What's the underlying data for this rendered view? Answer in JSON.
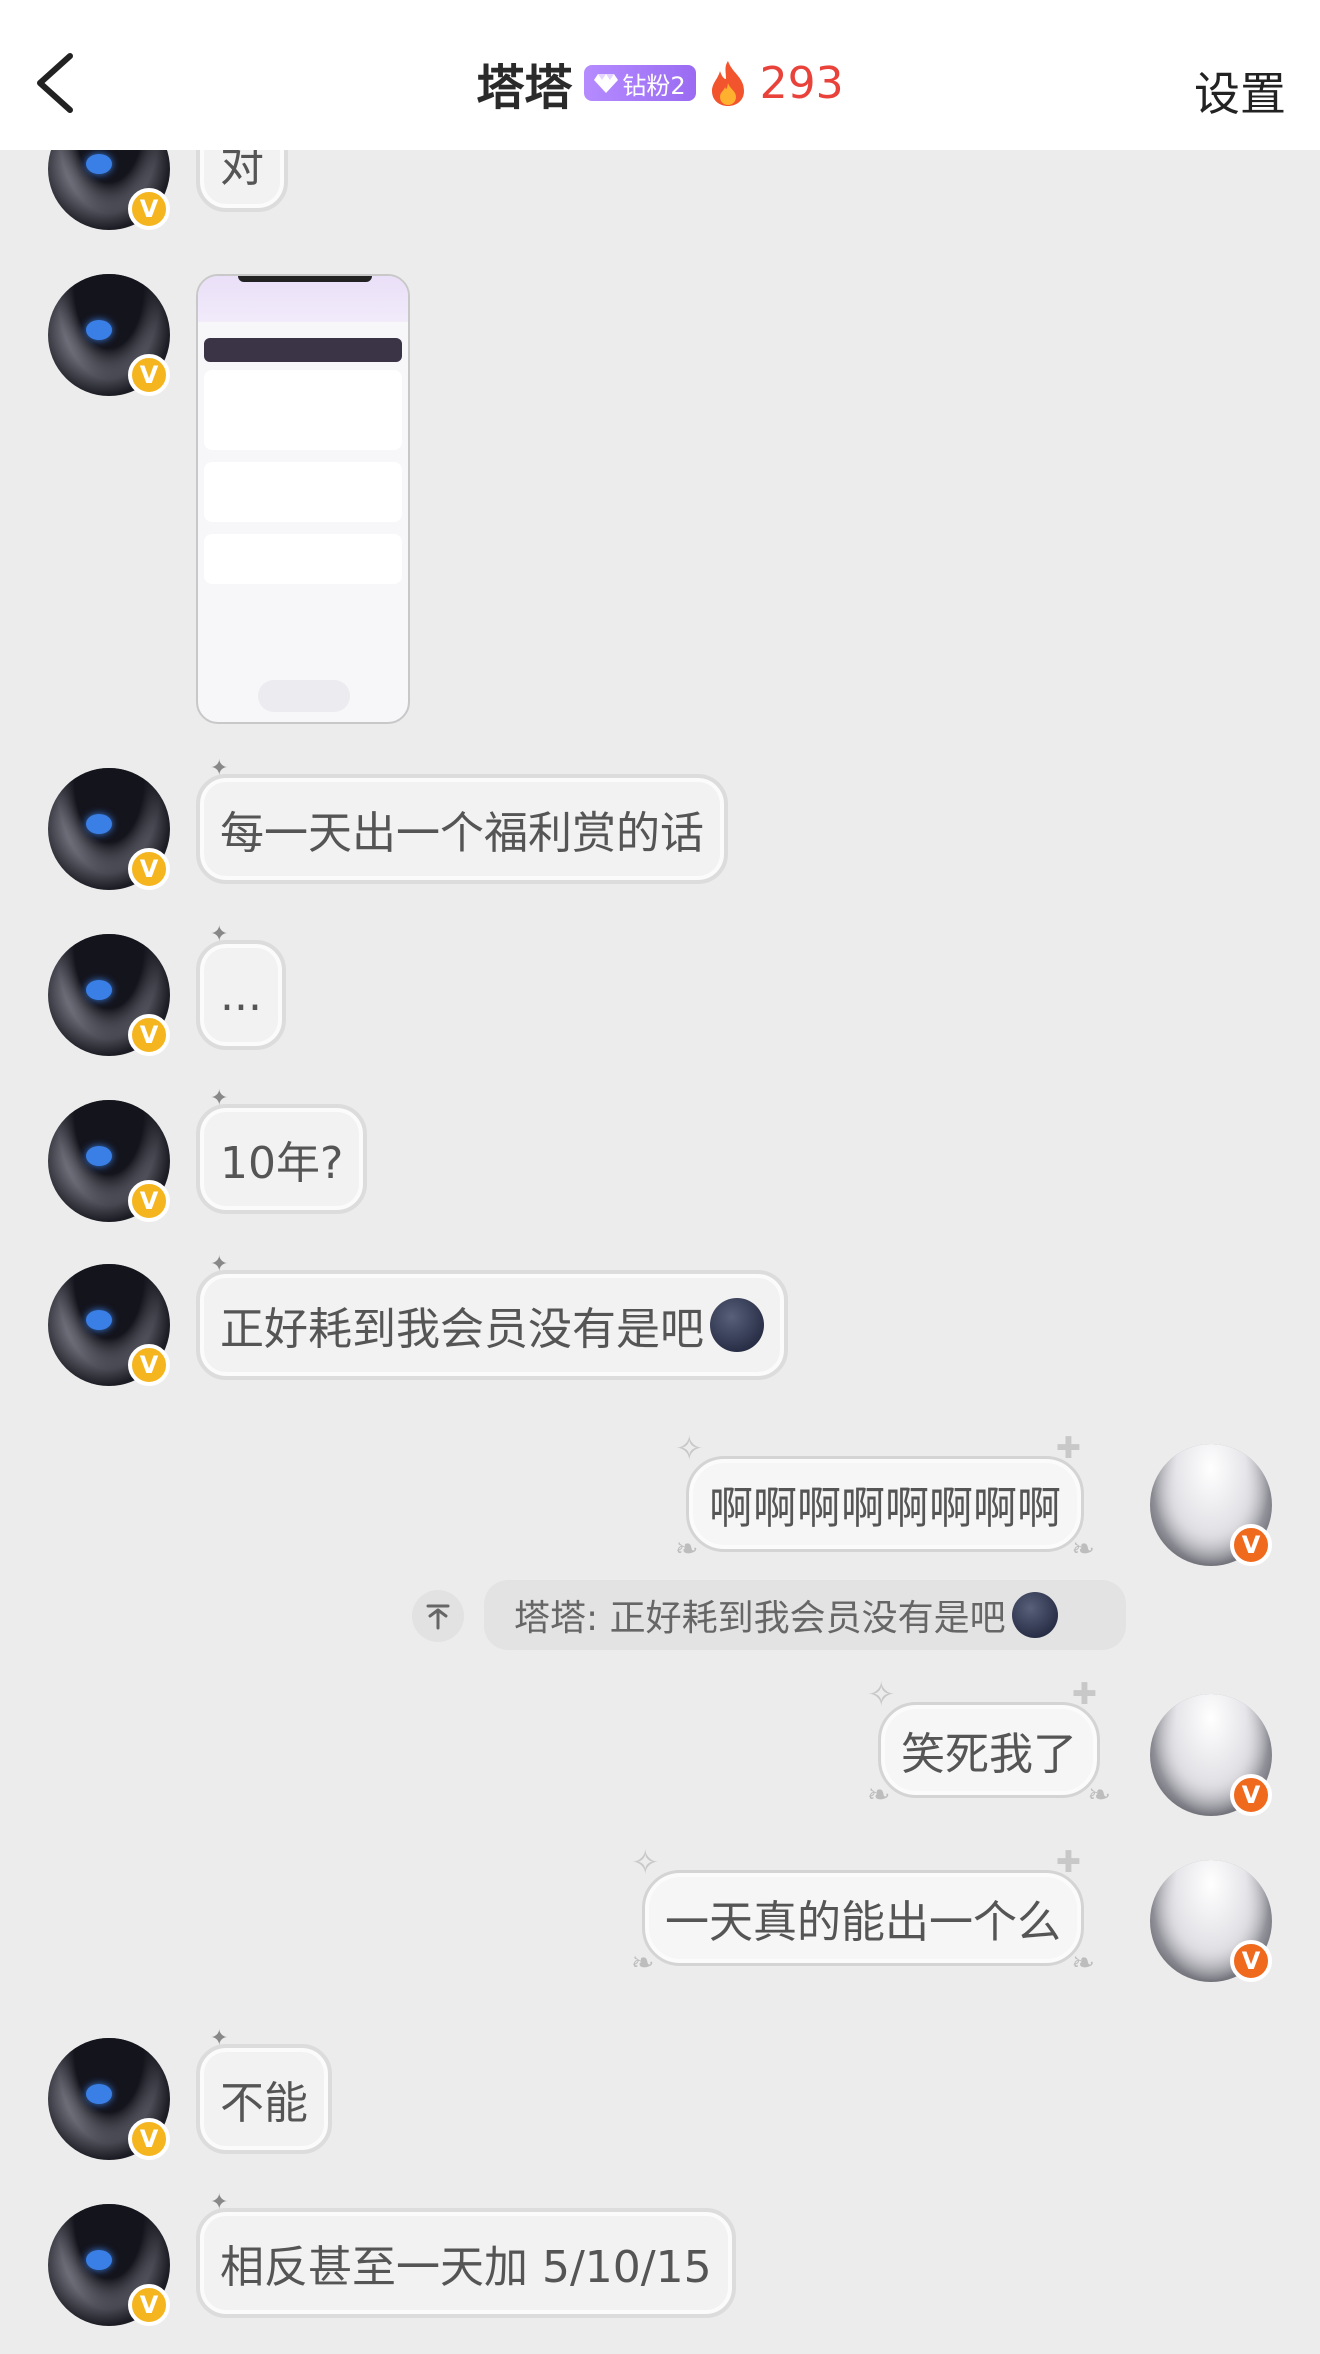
{
  "header": {
    "title": "塔塔",
    "fan_badge": "钻粉2",
    "fire_count": "293",
    "settings_label": "设置"
  },
  "messages": [
    {
      "side": "left",
      "text": "对"
    },
    {
      "side": "left",
      "type": "image"
    },
    {
      "side": "left",
      "text": "每一天出一个福利赏的话"
    },
    {
      "side": "left",
      "text": "..."
    },
    {
      "side": "left",
      "text": "10年?"
    },
    {
      "side": "left",
      "text": "正好耗到我会员没有是吧",
      "emoji": "new-moon-face-emoji"
    },
    {
      "side": "right",
      "text": "啊啊啊啊啊啊啊啊"
    },
    {
      "side": "right",
      "type": "quote",
      "text": "塔塔: 正好耗到我会员没有是吧",
      "emoji": "new-moon-face-emoji"
    },
    {
      "side": "right",
      "text": "笑死我了"
    },
    {
      "side": "right",
      "text": "一天真的能出一个么"
    },
    {
      "side": "left",
      "text": "不能"
    },
    {
      "side": "left",
      "text": "相反甚至一天加 5/10/15"
    }
  ],
  "colors": {
    "header_bg": "#ffffff",
    "page_bg": "#ececec",
    "fire": "#e8423a",
    "badge_purple": "#a57bf7",
    "badge_gold": "#f5b51e",
    "badge_orange": "#f06a1e"
  }
}
